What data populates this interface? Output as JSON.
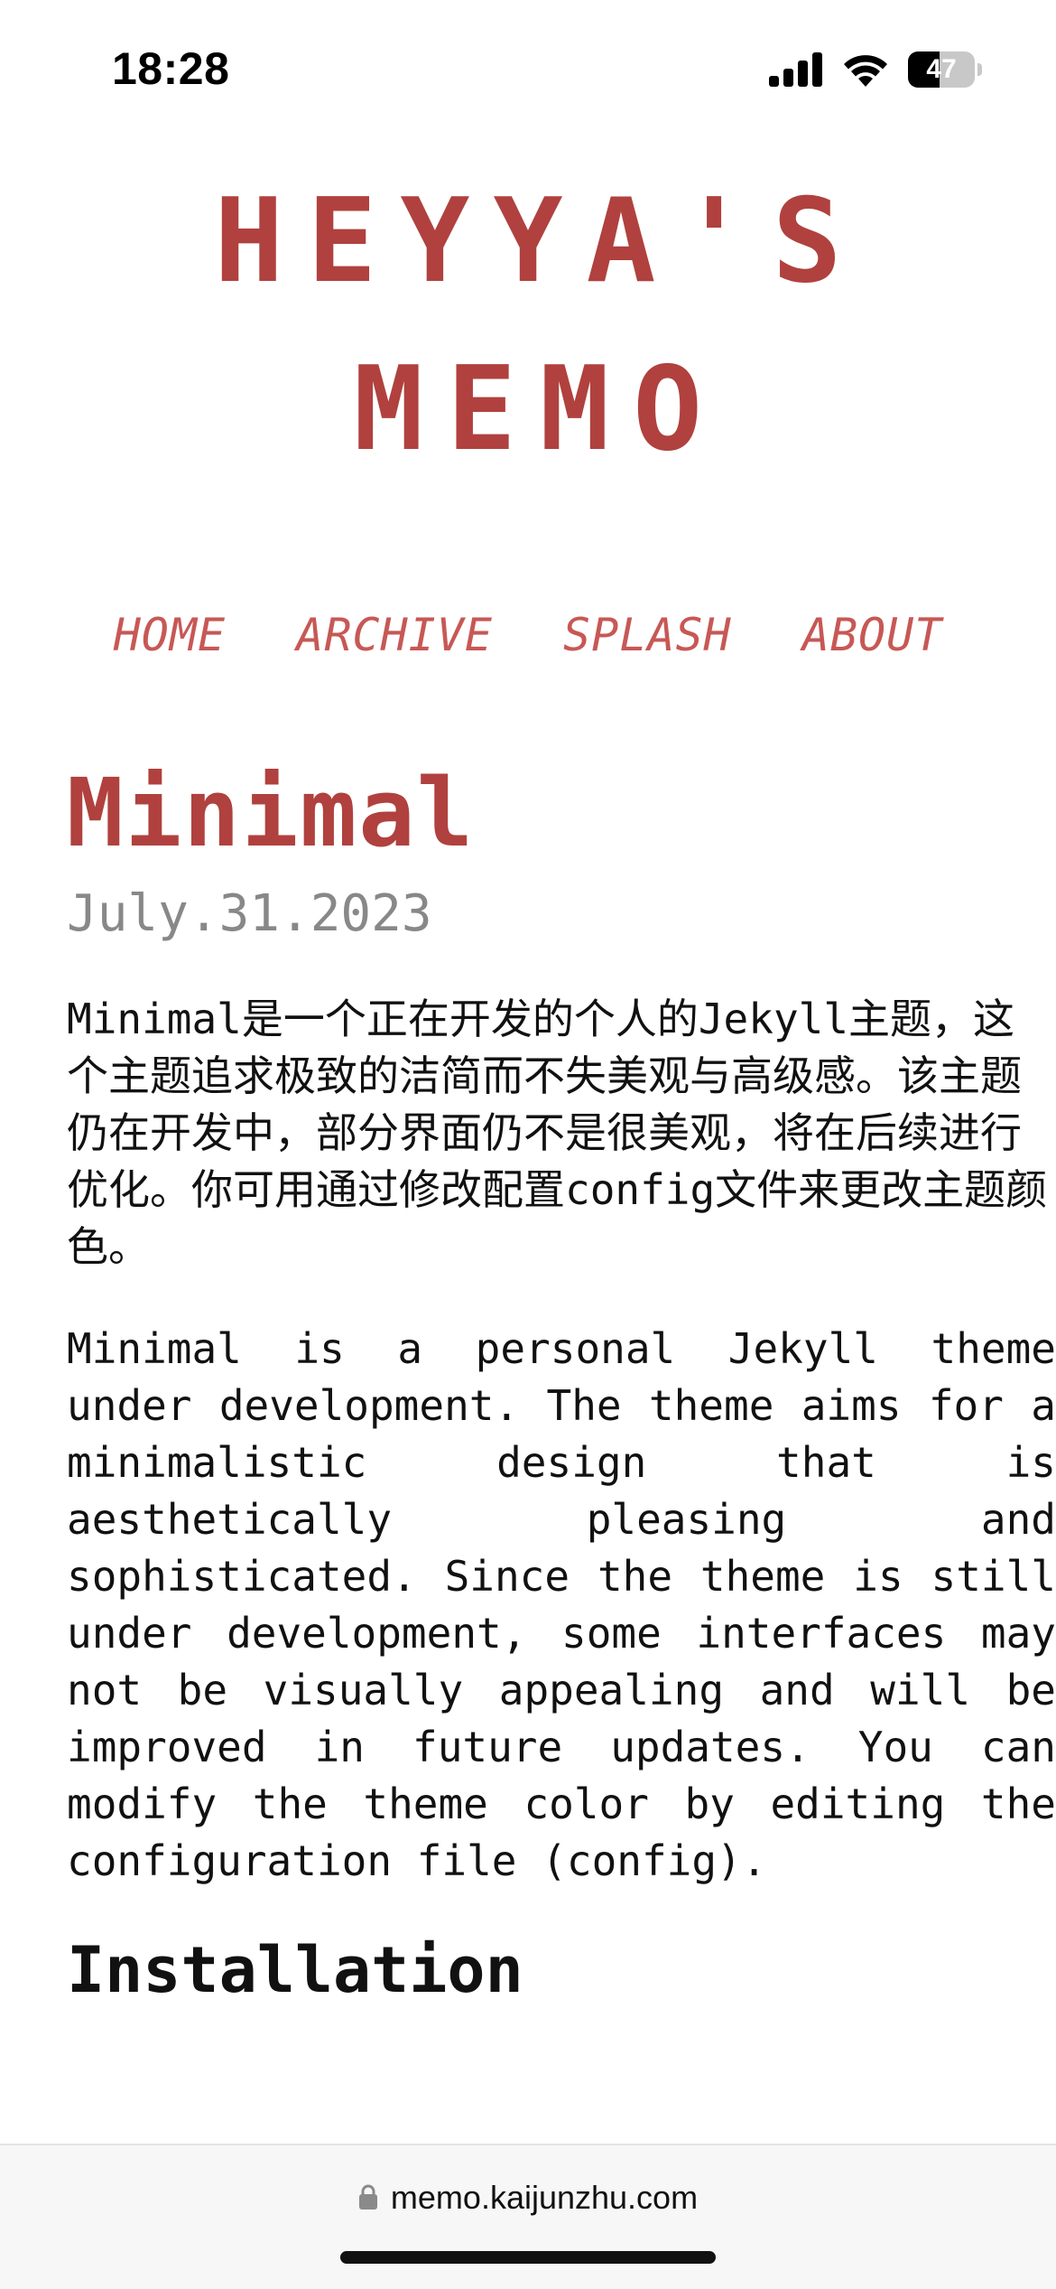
{
  "status_bar": {
    "time": "18:28",
    "battery_level": "47",
    "battery_fraction": 0.47
  },
  "site": {
    "title_line1": "HEYYA'S",
    "title_line2": "MEMO",
    "accent_color": "#b0413e"
  },
  "nav": {
    "items": [
      {
        "label": "HOME"
      },
      {
        "label": "ARCHIVE"
      },
      {
        "label": "SPLASH"
      },
      {
        "label": "ABOUT"
      }
    ]
  },
  "post": {
    "title": "Minimal",
    "date": "July.31.2023",
    "paragraph_cn": "Minimal是一个正在开发的个人的Jekyll主题，这个主题追求极致的洁简而不失美观与高级感。该主题仍在开发中，部分界面仍不是很美观，将在后续进行优化。你可用通过修改配置config文件来更改主题颜色。",
    "paragraph_en": "Minimal is a personal Jekyll theme under development. The theme aims for a minimalistic design that is aesthetically pleasing and sophisticated. Since the theme is still under development, some interfaces may not be visually appealing and will be improved in future updates. You can modify the theme color by editing the configuration file (config).",
    "section_heading": "Installation"
  },
  "browser": {
    "url": "memo.kaijunzhu.com",
    "lock_icon": "lock-icon"
  }
}
